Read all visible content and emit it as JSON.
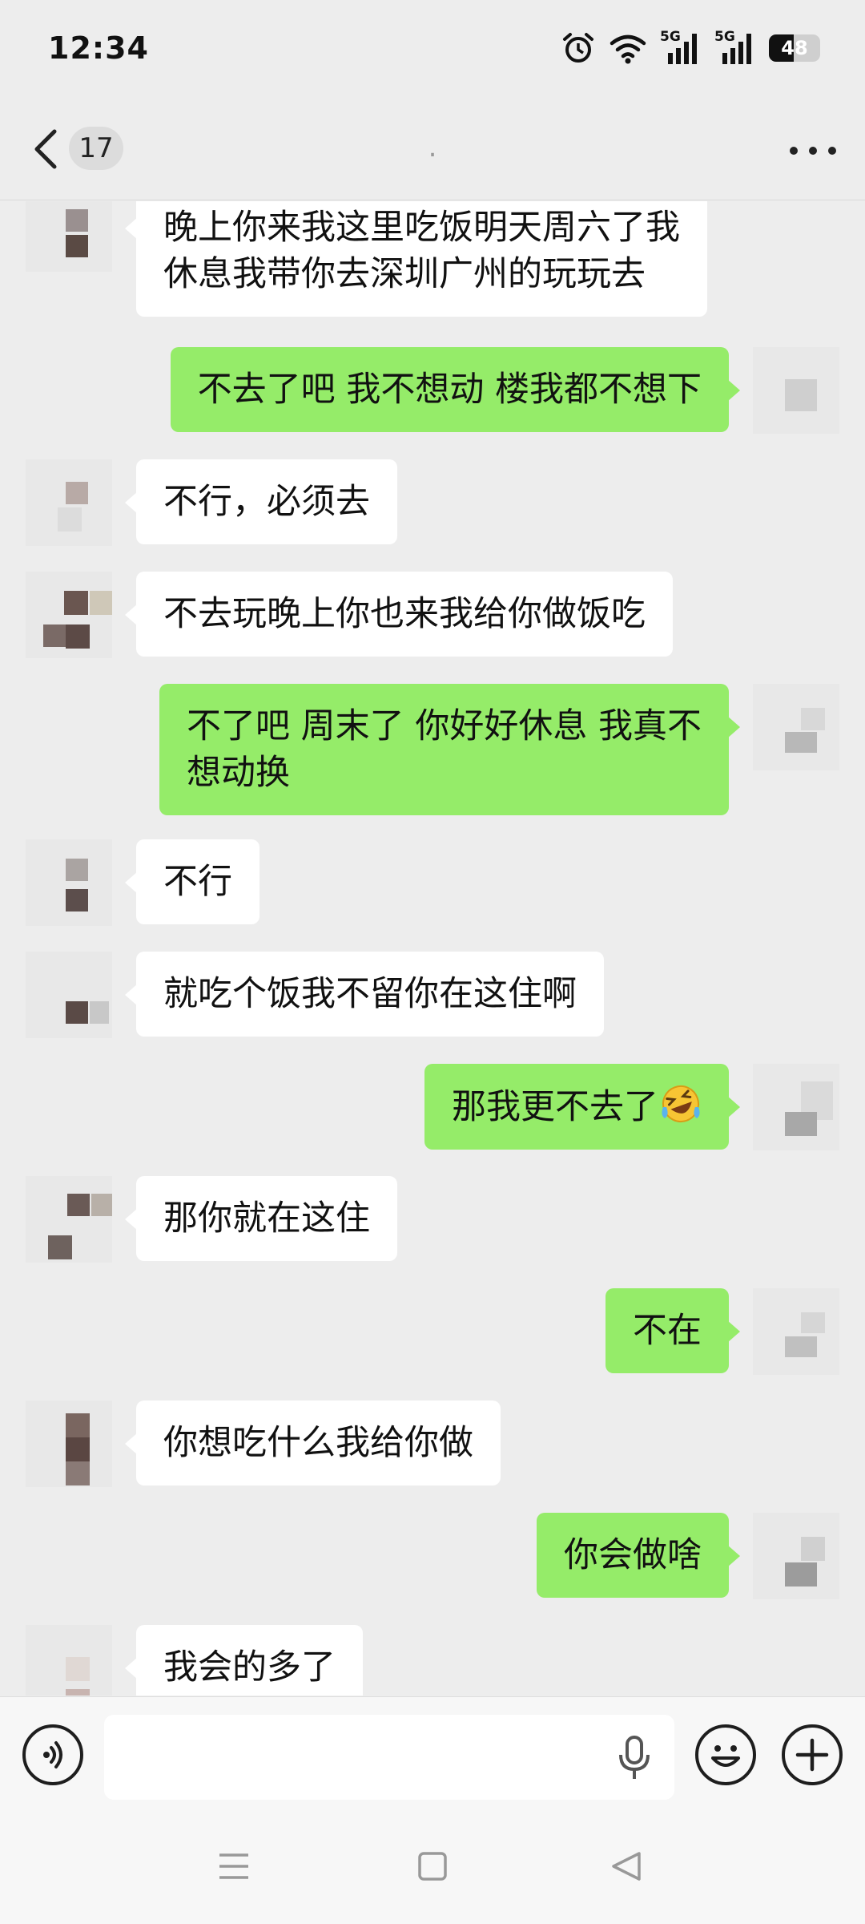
{
  "status_bar": {
    "time": "12:34",
    "network_labels": [
      "5G",
      "5G"
    ],
    "battery_level": "48",
    "icons": [
      "alarm-icon",
      "wifi-icon",
      "signal-icon",
      "signal-icon",
      "battery-icon"
    ]
  },
  "nav": {
    "unread_count": "17",
    "title": ".",
    "icons": [
      "back-chevron-icon",
      "more-dots-icon"
    ]
  },
  "colors": {
    "background": "#ededed",
    "outgoing_bubble": "#95ec69",
    "incoming_bubble": "#ffffff"
  },
  "messages": [
    {
      "side": "left",
      "lines": [
        "晚上你来我这里吃饭明天周六了我",
        "休息我带你去深圳广州的玩玩去"
      ]
    },
    {
      "side": "right",
      "lines": [
        "不去了吧 我不想动 楼我都不想下"
      ]
    },
    {
      "side": "left",
      "lines": [
        "不行，必须去"
      ]
    },
    {
      "side": "left",
      "lines": [
        "不去玩晚上你也来我给你做饭吃"
      ]
    },
    {
      "side": "right",
      "lines": [
        "不了吧 周末了 你好好休息 我真不",
        "想动换"
      ]
    },
    {
      "side": "left",
      "lines": [
        "不行"
      ]
    },
    {
      "side": "left",
      "lines": [
        "就吃个饭我不留你在这住啊"
      ]
    },
    {
      "side": "right",
      "lines": [
        "那我更不去了"
      ],
      "emoji": "laughing-crying-emoji"
    },
    {
      "side": "left",
      "lines": [
        "那你就在这住"
      ]
    },
    {
      "side": "right",
      "lines": [
        "不在"
      ]
    },
    {
      "side": "left",
      "lines": [
        "你想吃什么我给你做"
      ]
    },
    {
      "side": "right",
      "lines": [
        "你会做啥"
      ]
    },
    {
      "side": "left",
      "lines": [
        "我会的多了"
      ]
    }
  ],
  "input_bar": {
    "value": "",
    "icons": [
      "voice-icon",
      "mic-icon",
      "emoji-icon",
      "plus-icon"
    ]
  },
  "system_nav": {
    "icons": [
      "menu-icon",
      "home-square-icon",
      "back-triangle-icon"
    ]
  }
}
